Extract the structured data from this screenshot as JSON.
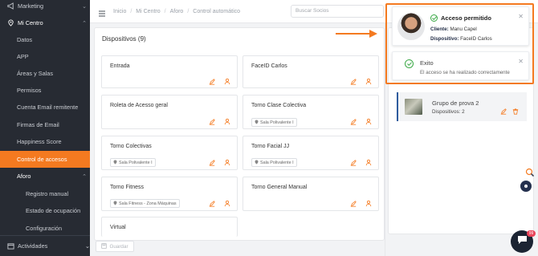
{
  "sidebar": {
    "items": [
      {
        "label": "Marketing",
        "chev": "⌄"
      },
      {
        "label": "Mi Centro",
        "chev": "⌃"
      },
      {
        "label": "Datos"
      },
      {
        "label": "APP"
      },
      {
        "label": "Áreas y Salas"
      },
      {
        "label": "Permisos"
      },
      {
        "label": "Cuenta Email remitente"
      },
      {
        "label": "Firmas de Email"
      },
      {
        "label": "Happiness Score"
      },
      {
        "label": "Control de accesos"
      },
      {
        "label": "Aforo",
        "chev": "⌃"
      },
      {
        "label": "Registro manual"
      },
      {
        "label": "Estado de ocupación"
      },
      {
        "label": "Configuración"
      }
    ],
    "bottom": {
      "label": "Actividades",
      "chev": "⌄"
    }
  },
  "topbar": {
    "breadcrumbs": [
      "Inicio",
      "Mi Centro",
      "Aforo",
      "Control automático"
    ],
    "search_placeholder": "Buscar Socios"
  },
  "devices": {
    "title": "Dispositivos (9)",
    "cards": [
      {
        "name": "Entrada",
        "tag": ""
      },
      {
        "name": "FaceID Carlos",
        "tag": ""
      },
      {
        "name": "Roleta de Acesso geral",
        "tag": ""
      },
      {
        "name": "Torno Clase Colectiva",
        "tag": "Sala Polivalente I"
      },
      {
        "name": "Torno Colectivas",
        "tag": "Sala Polivalente I"
      },
      {
        "name": "Torno Facial JJ",
        "tag": "Sala Polivalente I"
      },
      {
        "name": "Torno Fitness",
        "tag": "Sala Fitness - Zona Máquinas"
      },
      {
        "name": "Torno General Manual",
        "tag": ""
      },
      {
        "name": "Virtual",
        "tag": ""
      }
    ]
  },
  "save_label": "Guardar",
  "group": {
    "name": "Grupo de prova 2",
    "devices": "Dispositivos: 2"
  },
  "toast_access": {
    "title": "Acceso permitido",
    "client_label": "Cliente:",
    "client": "Manu Capel",
    "device_label": "Dispositivo:",
    "device": "FaceID Carlos"
  },
  "toast_success": {
    "title": "Exito",
    "message": "El acceso se ha realizado correctamente"
  },
  "chat_badge": "99",
  "colors": {
    "accent": "#f47a20",
    "sidebar": "#272b33",
    "success": "#3aa845",
    "group_border": "#2f5c9e"
  }
}
